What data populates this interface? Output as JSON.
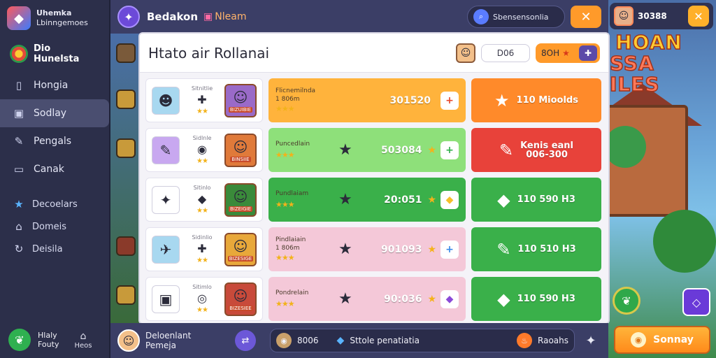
{
  "brand": {
    "line1": "Uhemka",
    "line2": "Lbinngemoes"
  },
  "sidebar": {
    "profile": "Dio Hunelsta",
    "items": [
      {
        "label": "Hongia",
        "icon": "book-icon"
      },
      {
        "label": "Sodlay",
        "icon": "sofa-icon",
        "active": true
      },
      {
        "label": "Pengals",
        "icon": "pin-icon"
      },
      {
        "label": "Canak",
        "icon": "chat-icon"
      }
    ],
    "sub_items": [
      {
        "label": "Decoelars",
        "icon": "star-icon"
      },
      {
        "label": "Domeis",
        "icon": "home-icon"
      },
      {
        "label": "Deisila",
        "icon": "cycle-icon"
      }
    ],
    "footer_line1": "Hlaly",
    "footer_line2": "Fouty",
    "footer_home": "Heos"
  },
  "topbar": {
    "title": "Bedakon",
    "subtitle": "Nleam",
    "search_placeholder": "Sbensensonlia"
  },
  "top_right": {
    "count": "30388"
  },
  "game_logo": {
    "line1": "HOAN",
    "line2": "SSA ILES"
  },
  "panel": {
    "title": "Htato air Rollanai",
    "count": "D06",
    "currency": "8OH"
  },
  "rows": [
    {
      "left": {
        "label": "Sitnitlie",
        "item_color": "#a8d8f0",
        "char_color": "#9a6ac8",
        "char_label": "BIZUIBIE"
      },
      "mid": {
        "name": "Flicnemilnda",
        "sub": "1 806m",
        "value": "301520",
        "bg": "#ffb33c",
        "btn": "+",
        "btn_color": "#e8482a"
      },
      "right": {
        "text1": "110 Mioolds",
        "text2": "",
        "bg": "#ff8a2a"
      }
    },
    {
      "left": {
        "label": "Sidlnle",
        "item_color": "#c8a8f0",
        "char_color": "#e07a3a",
        "char_label": "BINSIIE"
      },
      "mid": {
        "name": "Puncedlain",
        "sub": "",
        "value": "503084",
        "bg": "#8ee07a",
        "btn": "+",
        "btn_color": "#2fae4a"
      },
      "right": {
        "text1": "Kenis eanl",
        "text2": "006-300",
        "bg": "#e8423a"
      }
    },
    {
      "left": {
        "label": "Sitinlo",
        "item_color": "#ffffff",
        "char_color": "#3a8a3a",
        "char_label": "BIZEIGIE"
      },
      "mid": {
        "name": "Pundlaiam",
        "sub": "",
        "value": "20:051",
        "bg": "#3ab04a",
        "btn": "◆",
        "btn_color": "#f5c02a"
      },
      "right": {
        "text1": "110 590 H3",
        "text2": "",
        "bg": "#3ab04a"
      }
    },
    {
      "left": {
        "label": "Sidinlio",
        "item_color": "#a8d8f0",
        "char_color": "#e8a83a",
        "char_label": "BIZESIGE"
      },
      "mid": {
        "name": "Pindlaiain",
        "sub": "1 806m",
        "value": "901093",
        "bg": "#f4c8d8",
        "btn": "+",
        "btn_color": "#3a8ae8"
      },
      "right": {
        "text1": "110 510 H3",
        "text2": "",
        "bg": "#3ab04a"
      }
    },
    {
      "left": {
        "label": "Sitimlo",
        "item_color": "#ffffff",
        "char_color": "#c84a3a",
        "char_label": "BIZESIEE"
      },
      "mid": {
        "name": "Pondrelain",
        "sub": "",
        "value": "90:036",
        "bg": "#f4c8d8",
        "btn": "◆",
        "btn_color": "#8a4ad8"
      },
      "right": {
        "text1": "110 590 H3",
        "text2": "",
        "bg": "#3ab04a"
      }
    }
  ],
  "bottombar": {
    "user_line1": "Deloenlant",
    "user_line2": "Pemeja",
    "coins": "8006",
    "gem_label": "Sttole penatiatia",
    "fire_label": "Raoahs"
  },
  "sonnay_label": "Sonnay"
}
